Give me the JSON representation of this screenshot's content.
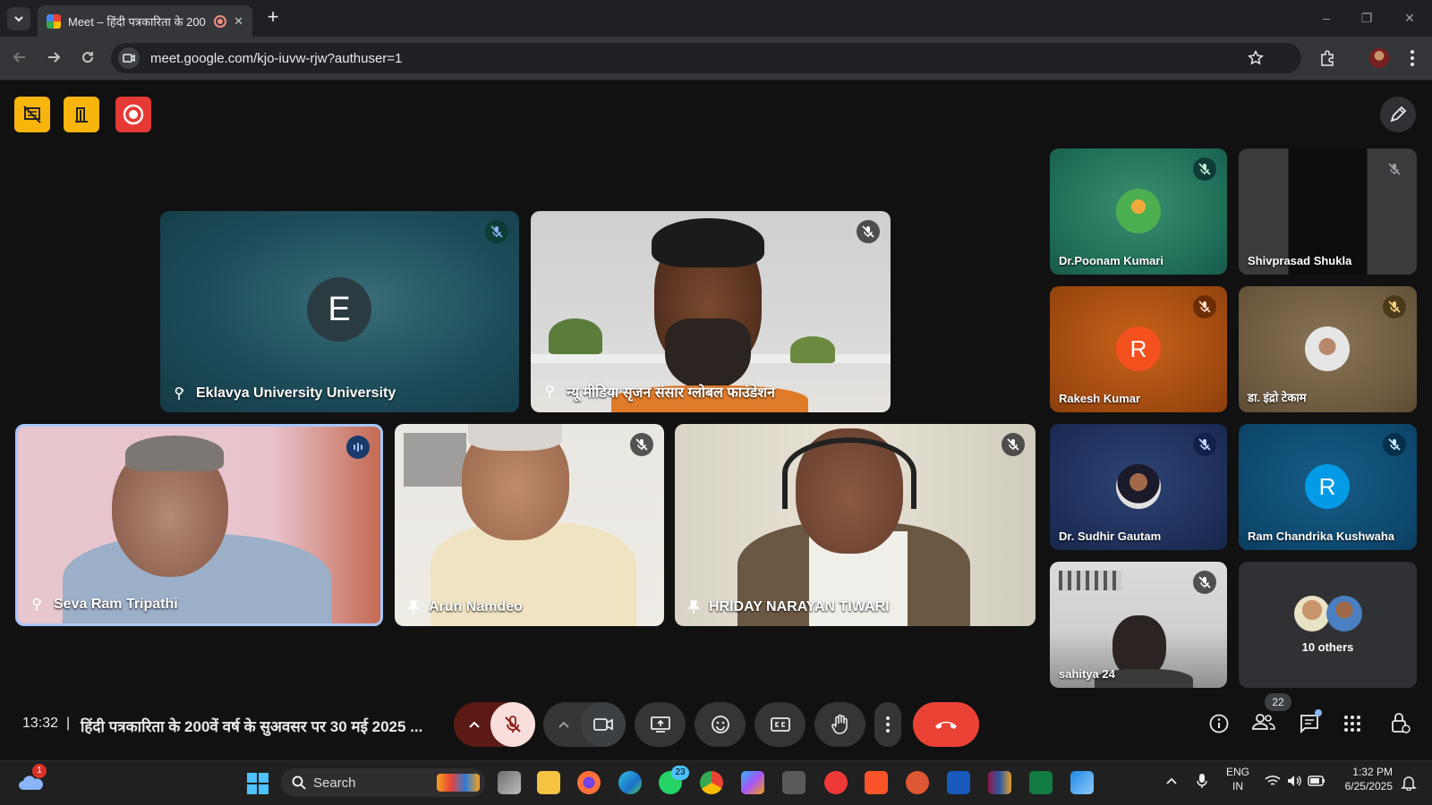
{
  "browser": {
    "tab_title": "Meet – हिंदी पत्रकारिता के 200",
    "new_tab": "+",
    "close_tab": "✕",
    "url": "meet.google.com/kjo-iuvw-rjw?authuser=1",
    "window_controls": [
      "–",
      "❐",
      "✕"
    ]
  },
  "tiles": {
    "eklavya": {
      "name": "Eklavya University University",
      "initial": "E"
    },
    "newmedia": {
      "name": "न्यू मीडिया सृजन संसार ग्लोबल फाउंडेशन"
    },
    "seva": {
      "name": "Seva Ram Tripathi"
    },
    "arun": {
      "name": "Arun Namdeo"
    },
    "hriday": {
      "name": "HRIDAY NARAYAN TIWARI"
    }
  },
  "side_tiles": [
    {
      "name": "Dr.Poonam Kumari"
    },
    {
      "name": "Shivprasad Shukla"
    },
    {
      "name": "Rakesh Kumar",
      "initial": "R"
    },
    {
      "name": "डा. इंद्रो टेकाम"
    },
    {
      "name": "Dr. Sudhir Gautam"
    },
    {
      "name": "Ram Chandrika Kushwaha",
      "initial": "R"
    },
    {
      "name": "sahitya 24"
    },
    {
      "name": "10 others"
    }
  ],
  "meeting": {
    "time": "13:32",
    "separator": "|",
    "title": "हिंदी पत्रकारिता के 200वें वर्ष के सुअवसर पर 30 मई 2025 ...",
    "participant_count": "22"
  },
  "taskbar": {
    "search_placeholder": "Search",
    "weather_badge": "1",
    "whatsapp_badge": "23",
    "lang": "ENG",
    "region": "IN",
    "time": "1:32 PM",
    "date": "6/25/2025"
  },
  "colors": {
    "end_call": "#ea4335",
    "mic_off_bg": "#f9dedc",
    "active_speaker_border": "#a8c7fa",
    "host_btn_yellow": "#f9b50b",
    "host_btn_red": "#e53935"
  }
}
